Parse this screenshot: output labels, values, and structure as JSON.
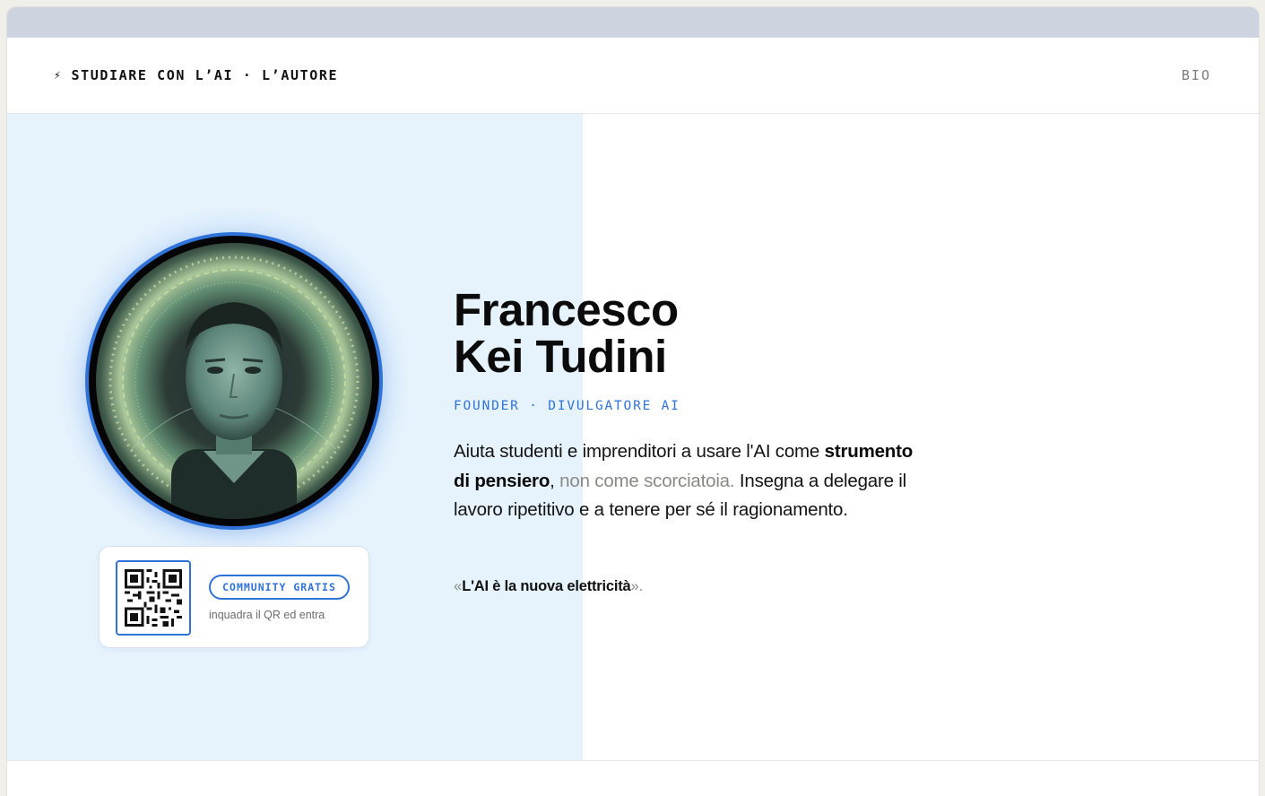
{
  "header": {
    "brand_icon": "lightning-bolt-icon",
    "brand_glyph": "⚡",
    "brand_text": "STUDIARE CON L’AI · L’AUTORE",
    "nav_bio": "BIO"
  },
  "profile": {
    "name_line1": "Francesco",
    "name_line2": "Kei Tudini",
    "role": "FOUNDER · DIVULGATORE AI",
    "bio_part1": "Aiuta studenti e imprenditori a usare l'AI come ",
    "bio_strong": "strumento di pensiero",
    "bio_comma": ",",
    "bio_muted": " non come scorciatoia.",
    "bio_part2": " Insegna a delegare il lavoro ripetitivo e a tenere per sé il ragionamento.",
    "quote_open": "«",
    "quote_text": "L'AI è la nuova elettricità",
    "quote_close": "».",
    "avatar_image": "author-portrait-photo"
  },
  "community": {
    "qr_icon": "qr-code-icon",
    "button_label": "COMMUNITY GRATIS",
    "hint": "inquadra il QR ed entra"
  },
  "colors": {
    "accent": "#2f73d9",
    "hero_left_bg": "#e6f3fd",
    "chrome_bar": "#cdd3df",
    "muted_text": "#8a8a85"
  }
}
